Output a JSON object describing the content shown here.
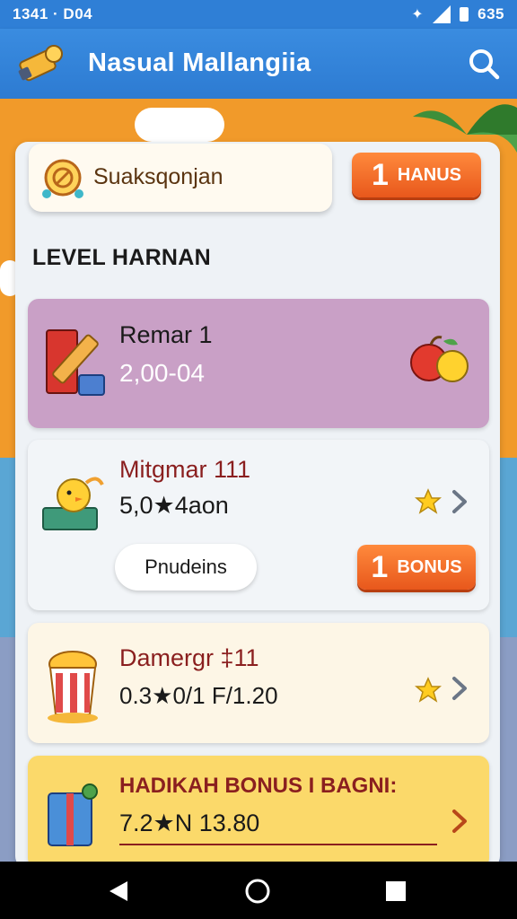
{
  "status_bar": {
    "time": "1341 · D04",
    "right_text": "635",
    "icons": [
      "vibrate-icon",
      "signal-icon",
      "battery-icon"
    ]
  },
  "app_bar": {
    "title": "Nasual Mallangiia",
    "icons": [
      "telescope-logo-icon",
      "search-icon"
    ]
  },
  "tab": {
    "label": "Suaksqonjan",
    "button_number": "1",
    "button_text": "HANUS"
  },
  "section_title": "LEVEL HARNAN",
  "rows": [
    {
      "name": "Remar 1",
      "value": "2,00-04",
      "icon": "books-icon",
      "trailing": "apple-fruit-icon"
    },
    {
      "name": "Mitgmar 111",
      "value": "5,0★4aon",
      "icon": "chick-on-book-icon",
      "trailing": "star-icon"
    },
    {
      "name": "Damergr ‡11",
      "value": "0.3★0/1 F/1.20",
      "icon": "popcorn-bucket-icon",
      "trailing": "star-icon"
    },
    {
      "name": "HADIKAH BONUS I BAGNI:",
      "value": "7.2★N 13.80",
      "icon": "gift-box-icon",
      "trailing": "chevron-right-icon"
    }
  ],
  "row2_pill": "Pnudeins",
  "row2_button": {
    "number": "1",
    "text": "BONUS"
  },
  "colors": {
    "status_bar": "#2f7fd6",
    "app_bar": "#3a8ce0",
    "accent_orange": "#e8581c",
    "row1_bg": "#c9a0c6",
    "row3_bg": "#fdf6e6",
    "row4_bg": "#fbd96a",
    "row_name_red": "#8a1f1f"
  }
}
